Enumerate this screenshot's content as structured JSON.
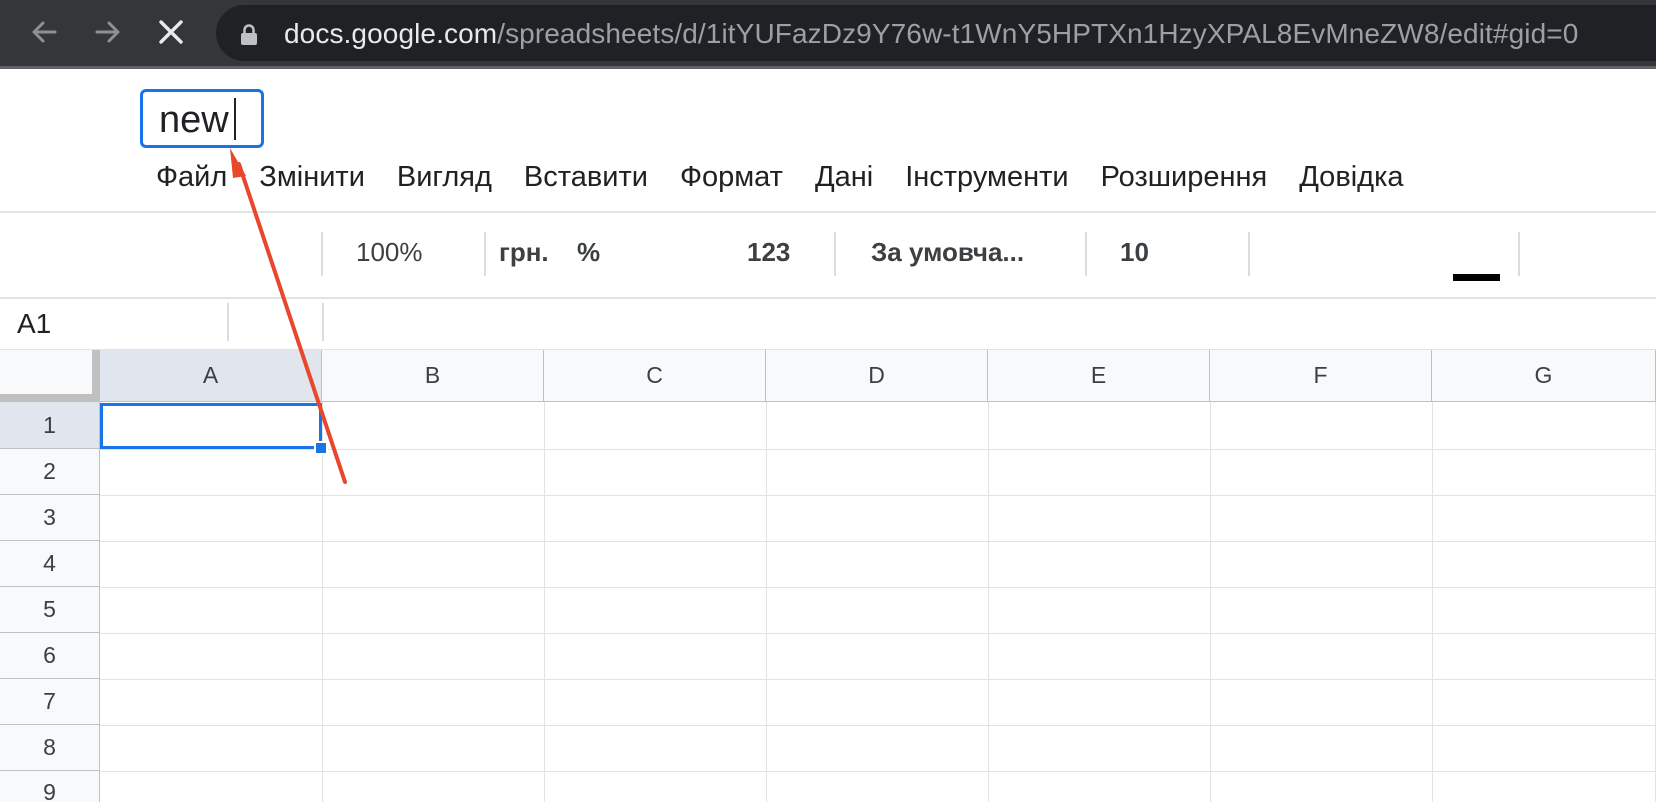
{
  "browser": {
    "url_host": "docs.google.com",
    "url_path": "/spreadsheets/d/1itYUFazDz9Y76w-t1WnY5HPTXn1HzyXPAL8EvMneZW8/edit#gid=0",
    "icons": [
      "back-arrow-icon",
      "forward-arrow-icon",
      "stop-loading-icon",
      "lock-icon"
    ]
  },
  "document": {
    "title_value": "new"
  },
  "menu": {
    "items": [
      "Файл",
      "Змінити",
      "Вигляд",
      "Вставити",
      "Формат",
      "Дані",
      "Інструменти",
      "Розширення",
      "Довідка"
    ]
  },
  "toolbar": {
    "zoom": "100%",
    "currency": "грн.",
    "percent": "%",
    "more_formats": "123",
    "font": "За умовча...",
    "font_size": "10",
    "text_color": "#000000"
  },
  "formula_bar": {
    "name_box": "A1"
  },
  "grid": {
    "columns": [
      "A",
      "B",
      "C",
      "D",
      "E",
      "F",
      "G"
    ],
    "rows": [
      "1",
      "2",
      "3",
      "4",
      "5",
      "6",
      "7",
      "8",
      "9"
    ],
    "selected_cell": "A1",
    "selection_color": "#1a73e8"
  },
  "annotation": {
    "arrow_color": "#e8472b"
  }
}
